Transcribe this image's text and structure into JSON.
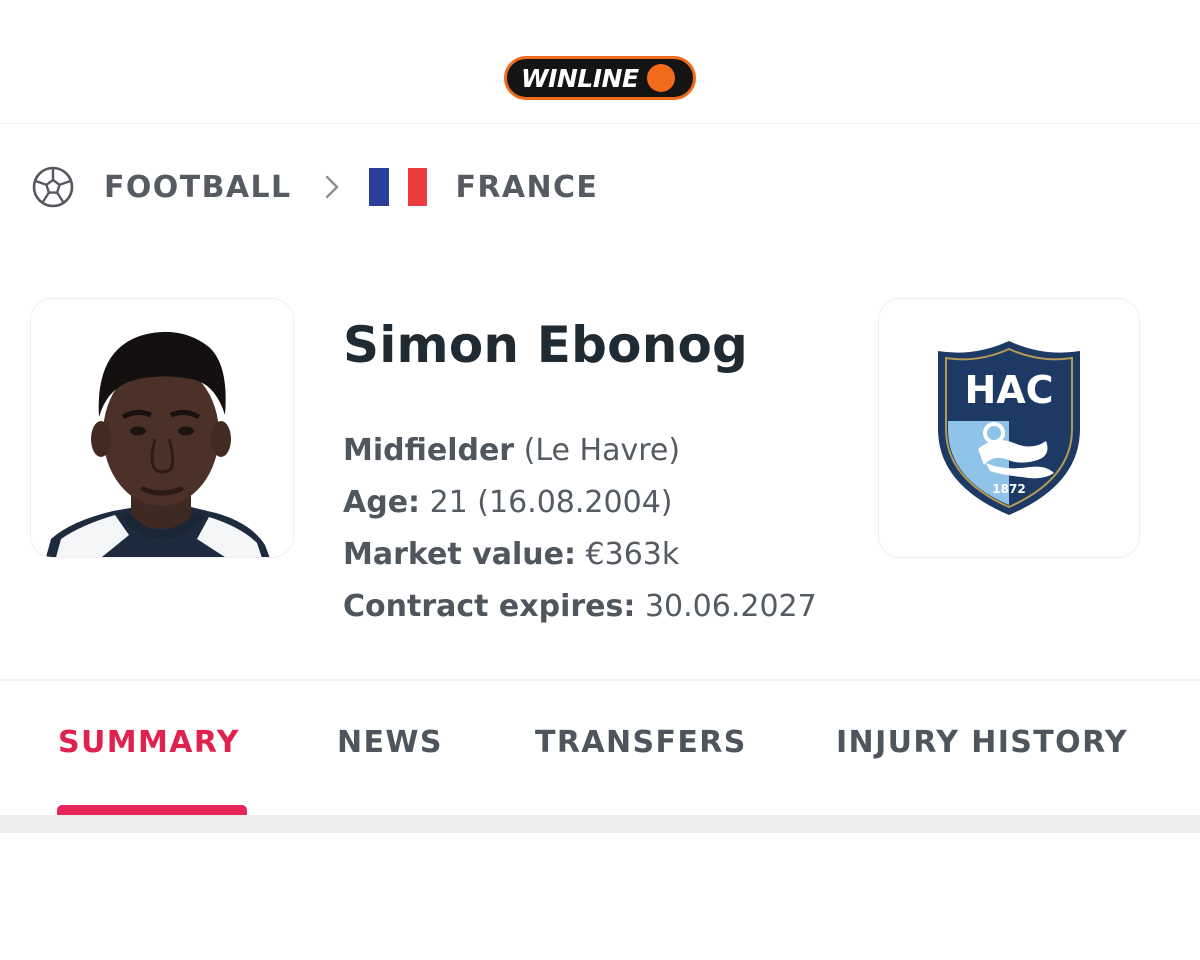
{
  "brand": {
    "name": "WINLINE",
    "colors": {
      "badge_bg": "#141414",
      "accent": "#f26a1b"
    }
  },
  "breadcrumb": {
    "sport_icon": "soccer-ball-icon",
    "sport": "FOOTBALL",
    "separator_icon": "chevron-right-icon",
    "country_flag": "france-flag-icon",
    "country": "FRANCE"
  },
  "player": {
    "name": "Simon Ebonog",
    "photo_icon": "player-photo",
    "position_label": "Midfielder",
    "club_paren": "(Le Havre)",
    "age_label": "Age:",
    "age_value": "21 (16.08.2004)",
    "market_label": "Market value:",
    "market_value": "€363k",
    "contract_label": "Contract expires:",
    "contract_value": "30.06.2027"
  },
  "club": {
    "crest_icon": "club-crest-icon",
    "crest_text": "HAC",
    "crest_year": "1872",
    "colors": {
      "navy": "#1c3a64",
      "sky": "#8fc3e8"
    }
  },
  "tabs": [
    {
      "label": "SUMMARY",
      "active": true
    },
    {
      "label": "NEWS",
      "active": false
    },
    {
      "label": "TRANSFERS",
      "active": false
    },
    {
      "label": "INJURY HISTORY",
      "active": false
    }
  ],
  "colors": {
    "active_tab": "#e0224f"
  }
}
